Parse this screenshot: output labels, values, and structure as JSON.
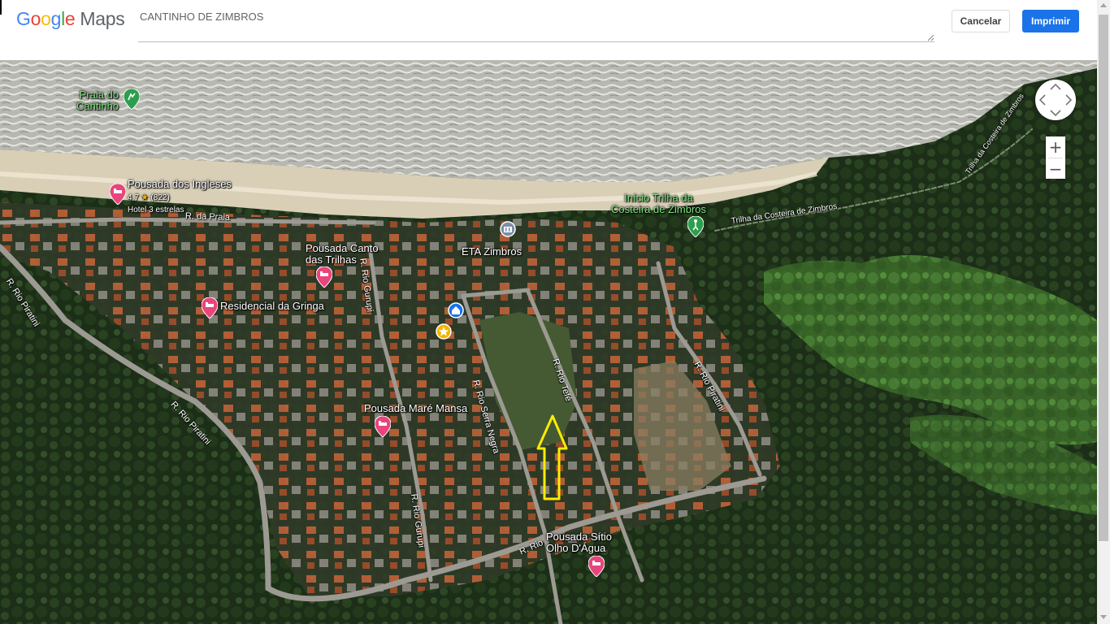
{
  "app": {
    "logo_parts": [
      "G",
      "o",
      "o",
      "g",
      "l",
      "e"
    ],
    "logo_suffix": "Maps"
  },
  "notes_field": {
    "value": "CANTINHO DE ZIMBROS"
  },
  "buttons": {
    "cancel_label": "Cancelar",
    "print_label": "Imprimir"
  },
  "map": {
    "view": "satellite",
    "places": {
      "praia_do_cantinho": "Praia do\nCantinho",
      "pousada_ingleses": "Pousada dos Ingleses",
      "pousada_ingleses_rating": "4,7",
      "pousada_ingleses_reviews": "(822)",
      "pousada_ingleses_class": "Hotel 3 estrelas",
      "pousada_canto": "Pousada Canto\ndas Trilhas",
      "eta_zimbros": "ETA Zimbros",
      "residencial_gringa": "Residencial da Gringa",
      "pousada_mare": "Pousada Maré Mansa",
      "pousada_sitio": "Pousada Sítio\nOlho D'Água",
      "inicio_trilha": "Início Trilha da\nCosteira de Zimbros"
    },
    "streets": {
      "r_da_praia": "R. da Praia",
      "r_rio_piratini_left": "R. Rio Piratini",
      "r_rio_piratini_mid": "R. Rio Piratini",
      "r_rio_gurupi_top": "R. Rio Gurupi",
      "r_rio_gurupi_bottom": "R. Rio Gurupi",
      "r_rio_serra_negra": "R. Rio Serra Negra",
      "r_rio_tefe": "R. Rio Tefé",
      "r_rio_piratini_right": "R. Rio Piratini",
      "r_rio_bottom": "R. Rio",
      "trilha_costeira": "Trilha da Costeira de Zimbros",
      "trilha_costeira_diag": "Trilha da Costeira de Zimbros"
    },
    "annotation": "yellow-arrow-up",
    "colors": {
      "accent_blue": "#1a73e8",
      "pin_pink": "#e8457d",
      "pin_green": "#2e9e4e",
      "annotation_yellow": "#ffeb00"
    }
  }
}
